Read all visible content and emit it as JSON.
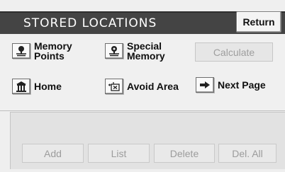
{
  "header": {
    "title": "STORED LOCATIONS",
    "return_label": "Return"
  },
  "menu": {
    "memory_points": {
      "label_line1": "Memory",
      "label_line2": "Points",
      "icon": "memory-pin-icon"
    },
    "special_memory": {
      "label_line1": "Special",
      "label_line2": "Memory",
      "icon": "special-memory-pin-icon"
    },
    "calculate": {
      "label": "Calculate",
      "enabled": false
    },
    "home": {
      "label": "Home",
      "icon": "home-icon"
    },
    "avoid_area": {
      "label": "Avoid Area",
      "icon": "avoid-area-icon"
    },
    "next_page": {
      "label": "Next Page",
      "icon": "right-arrow-icon"
    }
  },
  "actions": [
    {
      "label": "Add",
      "enabled": false
    },
    {
      "label": "List",
      "enabled": false
    },
    {
      "label": "Delete",
      "enabled": false
    },
    {
      "label": "Del. All",
      "enabled": false
    }
  ],
  "colors": {
    "header_bg": "#444444",
    "disabled_text": "#9c9c9c"
  }
}
